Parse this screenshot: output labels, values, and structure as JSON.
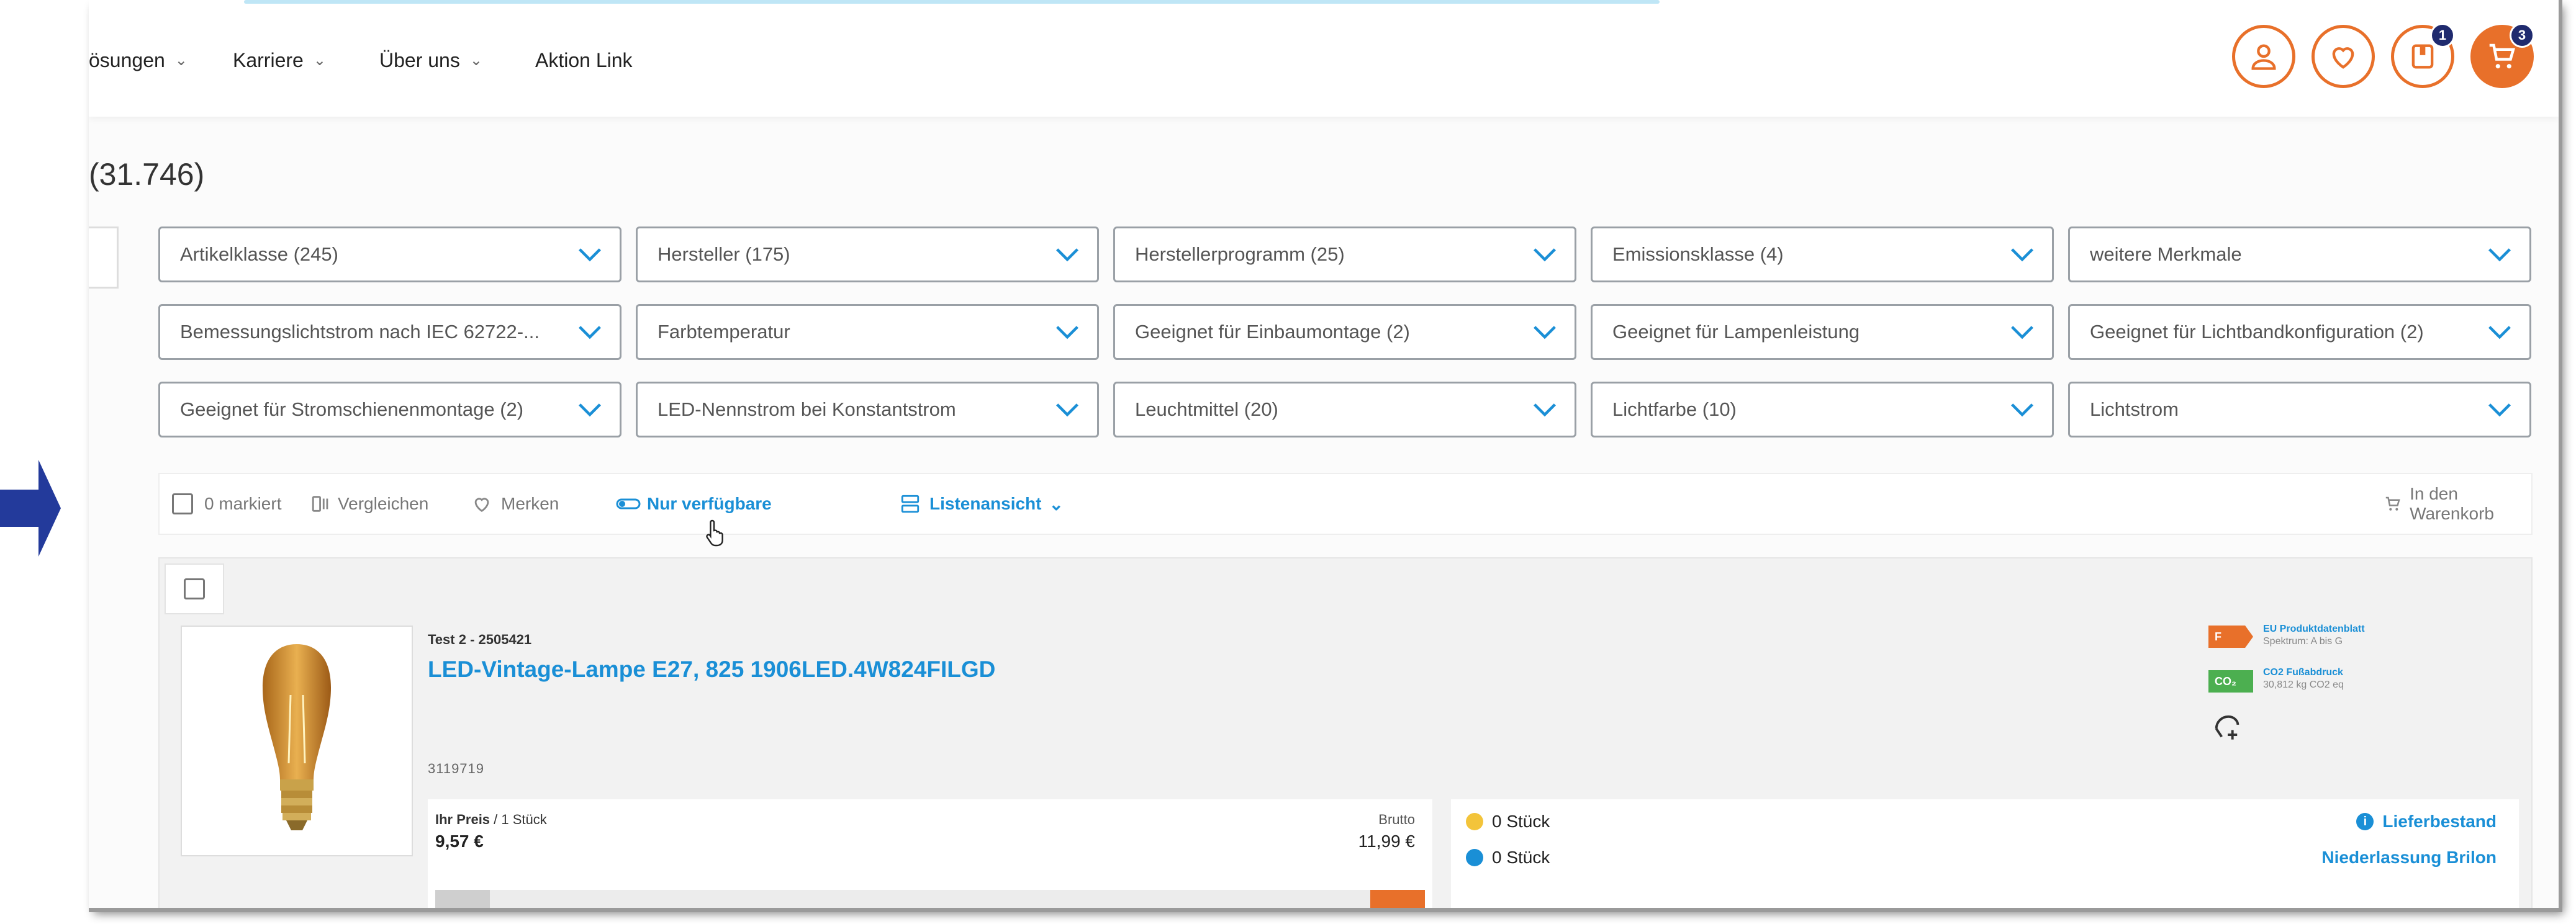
{
  "nav": {
    "items": [
      {
        "label": "ösungen",
        "has_dropdown": true
      },
      {
        "label": "Karriere",
        "has_dropdown": true
      },
      {
        "label": "Über uns",
        "has_dropdown": true
      },
      {
        "label": "Aktion Link",
        "has_dropdown": false
      }
    ],
    "icons": [
      "user-icon",
      "heart-icon",
      "orders-icon",
      "cart-icon"
    ],
    "orders_badge": "1",
    "cart_badge": "3"
  },
  "result_count": "(31.746)",
  "filters": [
    {
      "label": "Artikelklasse (245)"
    },
    {
      "label": "Hersteller (175)"
    },
    {
      "label": "Herstellerprogramm (25)"
    },
    {
      "label": "Emissionsklasse (4)"
    },
    {
      "label": "weitere Merkmale"
    },
    {
      "label": "Bemessungslichtstrom nach IEC 62722-..."
    },
    {
      "label": "Farbtemperatur"
    },
    {
      "label": "Geeignet für Einbaumontage (2)"
    },
    {
      "label": "Geeignet für Lampenleistung"
    },
    {
      "label": "Geeignet für Lichtbandkonfiguration (2)"
    },
    {
      "label": "Geeignet für Stromschienenmontage (2)"
    },
    {
      "label": "LED-Nennstrom bei Konstantstrom"
    },
    {
      "label": "Leuchtmittel (20)"
    },
    {
      "label": "Lichtfarbe (10)"
    },
    {
      "label": "Lichtstrom"
    }
  ],
  "toolbar": {
    "marked": "0 markiert",
    "compare": "Vergleichen",
    "remember": "Merken",
    "only_available": "Nur verfügbare",
    "list_view": "Listenansicht",
    "add_to_cart": "In den Warenkorb"
  },
  "product": {
    "subtitle": "Test 2 - 2505421",
    "title": "LED-Vintage-Lampe E27, 825 1906LED.4W824FILGD",
    "article_no": "3119719",
    "price_label": "Ihr Preis",
    "price_unit": " / 1 Stück",
    "price": "9,57 €",
    "brutto_label": "Brutto",
    "brutto": "11,99 €",
    "stock": [
      {
        "qty": "0 Stück",
        "color": "#f3c43a"
      },
      {
        "qty": "0 Stück",
        "color": "#1a8fd6"
      }
    ],
    "stock_links": [
      "Lieferbestand",
      "Niederlassung Brilon"
    ],
    "energy_class": "F",
    "energy_title": "EU Produktdatenblatt",
    "energy_sub": "Spektrum: A bis G",
    "co2_label": "CO₂",
    "co2_title": "CO2 Fußabdruck",
    "co2_sub": "30,812 kg CO2 eq"
  },
  "colors": {
    "accent": "#e8702a",
    "link": "#1a8fd6",
    "arrow": "#233a9b",
    "badge": "#1f2a6e",
    "energy_f": "#e8702a",
    "co2": "#4caf50"
  }
}
